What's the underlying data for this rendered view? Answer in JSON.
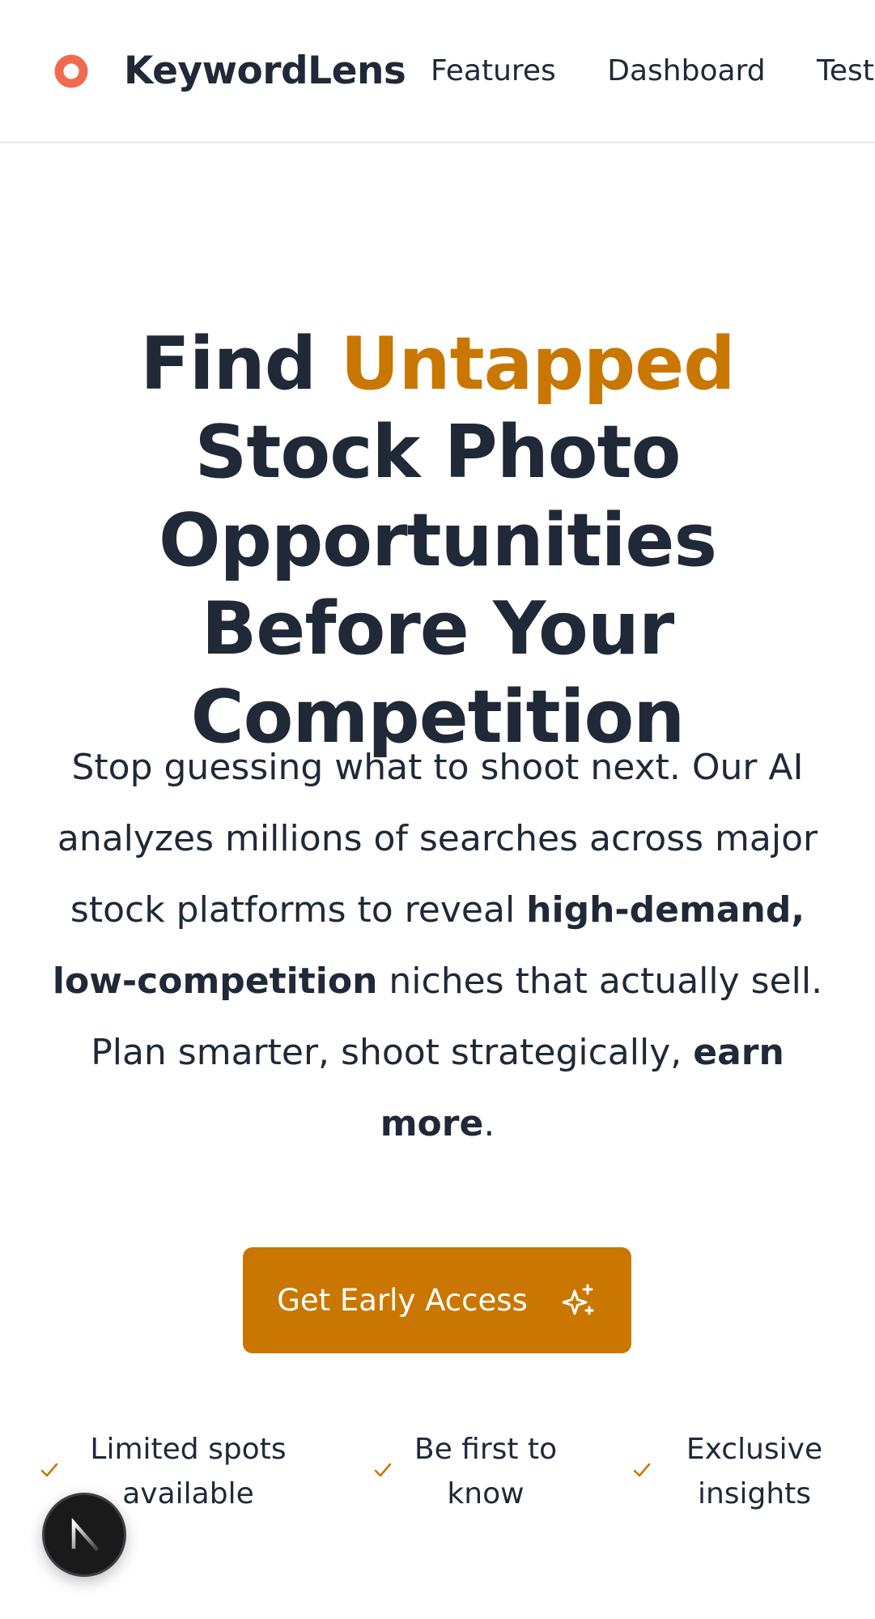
{
  "header": {
    "brand": "KeywordLens",
    "nav": [
      {
        "label": "Features"
      },
      {
        "label": "Dashboard"
      },
      {
        "label": "Testi"
      }
    ]
  },
  "hero": {
    "title_part1": "Find ",
    "title_accent": "Untapped",
    "title_part2": " Stock Photo Opportunities Before Your Competition",
    "sub_part1": "Stop guessing what to shoot next. Our AI analyzes millions of searches across major stock platforms to reveal ",
    "sub_bold1": "high-demand, low-competition",
    "sub_part2": " niches that actually sell. Plan smarter, shoot strategically, ",
    "sub_bold2": "earn more",
    "sub_part3": "."
  },
  "cta": {
    "label": "Get Early Access",
    "icon": "sparkles-icon"
  },
  "perks": [
    {
      "label": "Limited spots available",
      "icon": "check-icon"
    },
    {
      "label": "Be first to know",
      "icon": "check-icon"
    },
    {
      "label": "Exclusive insights",
      "icon": "check-icon"
    }
  ],
  "fab": {
    "icon": "next-logo-icon"
  },
  "colors": {
    "accent": "#c97700",
    "logo": "#ef6b4e",
    "text": "#1f2937"
  }
}
